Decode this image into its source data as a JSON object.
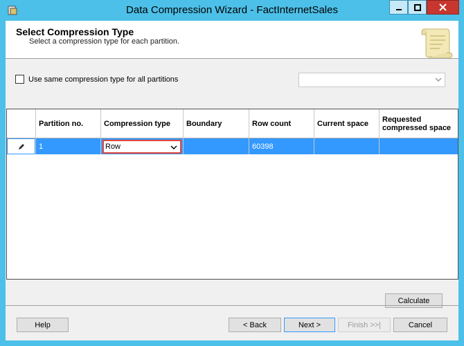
{
  "window": {
    "title": "Data Compression Wizard - FactInternetSales"
  },
  "header": {
    "title": "Select Compression Type",
    "subtitle": "Select a compression type for each partition."
  },
  "options": {
    "same_type_label": "Use same compression type for all partitions",
    "same_type_checked": false,
    "same_type_select_value": ""
  },
  "grid": {
    "columns": [
      "Partition no.",
      "Compression type",
      "Boundary",
      "Row count",
      "Current space",
      "Requested compressed space"
    ],
    "rows": [
      {
        "partition_no": "1",
        "compression_type": "Row",
        "boundary": "",
        "row_count": "60398",
        "current_space": "",
        "requested_space": ""
      }
    ]
  },
  "buttons": {
    "calculate": "Calculate",
    "help": "Help",
    "back": "< Back",
    "next": "Next >",
    "finish": "Finish >>|",
    "cancel": "Cancel"
  },
  "colors": {
    "titlebar": "#4cc0e8",
    "selection": "#3399ff",
    "highlight_border": "#e0473b",
    "close": "#c7372f"
  },
  "icons": {
    "app": "wizard-app-icon",
    "row_selector": "pencil-icon",
    "header_art": "scroll-icon"
  }
}
